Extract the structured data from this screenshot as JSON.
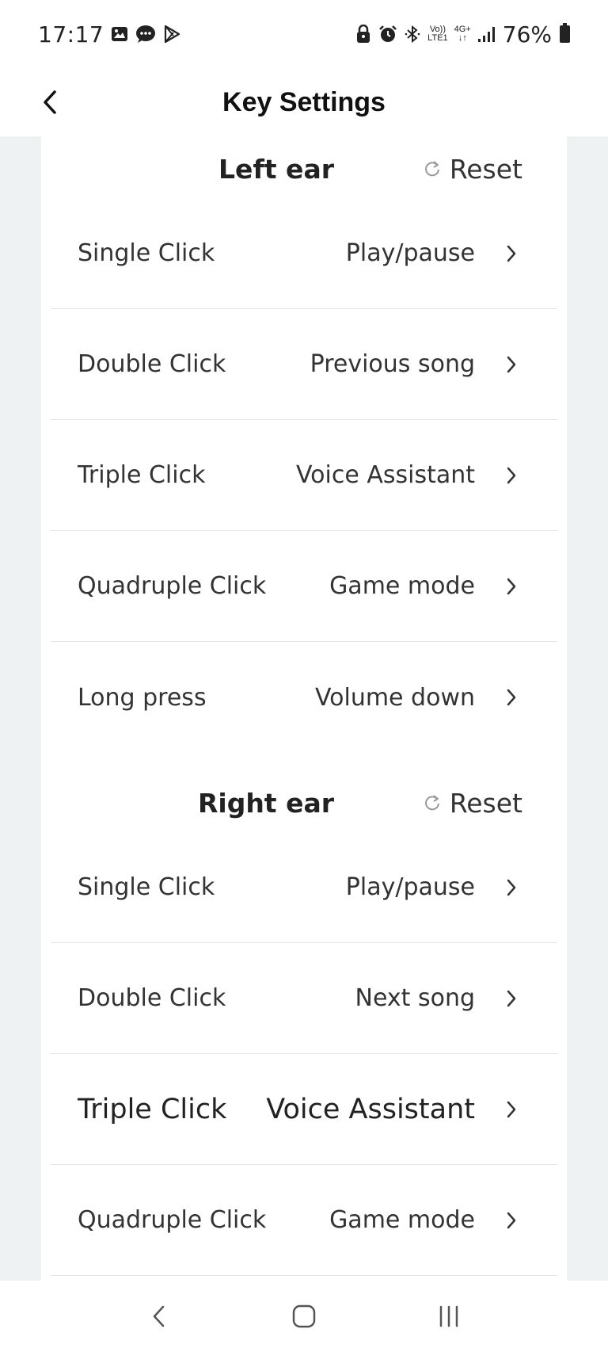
{
  "status_bar": {
    "time": "17:17",
    "battery_percent": "76%",
    "network_top": "Vo))",
    "network_bottom": "LTE1",
    "network_type": "4G+",
    "left_icons": [
      "gallery-icon",
      "chat-bubble-icon",
      "play-store-icon"
    ],
    "right_icons": [
      "lock-icon",
      "alarm-icon",
      "bluetooth-icon",
      "signal-icon",
      "battery-icon"
    ]
  },
  "app_bar": {
    "title": "Key Settings",
    "back_icon": "chevron-left-icon"
  },
  "left_ear": {
    "title": "Left ear",
    "reset_label": "Reset",
    "rows": [
      {
        "label": "Single Click",
        "value": "Play/pause"
      },
      {
        "label": "Double Click",
        "value": "Previous song"
      },
      {
        "label": "Triple Click",
        "value": "Voice Assistant"
      },
      {
        "label": "Quadruple Click",
        "value": "Game mode"
      },
      {
        "label": "Long press",
        "value": "Volume down"
      }
    ]
  },
  "right_ear": {
    "title": "Right ear",
    "reset_label": "Reset",
    "rows": [
      {
        "label": "Single Click",
        "value": "Play/pause"
      },
      {
        "label": "Double Click",
        "value": "Next song"
      },
      {
        "label": "Triple Click",
        "value": "Voice Assistant"
      },
      {
        "label": "Quadruple Click",
        "value": "Game mode"
      }
    ]
  },
  "nav_bar": {
    "icons": [
      "back-icon",
      "home-icon",
      "recents-icon"
    ]
  },
  "colors": {
    "background": "#eef2f2",
    "card": "#ffffff",
    "text": "#333333",
    "divider": "#e6e6e6"
  }
}
